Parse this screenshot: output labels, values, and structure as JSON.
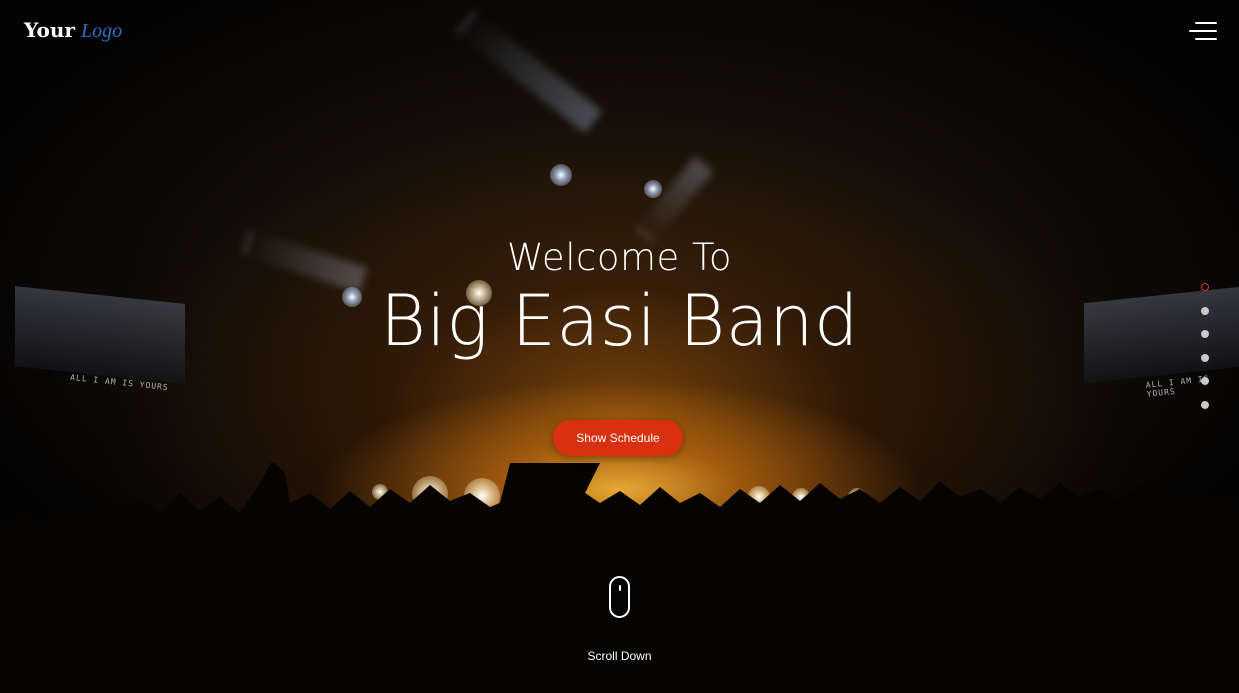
{
  "header": {
    "logo_word_1": "Your",
    "logo_word_2": "Logo",
    "menu_icon": "hamburger-menu-icon"
  },
  "hero": {
    "welcome_text": "Welcome To",
    "band_name": "Big Easi Band",
    "cta_label": "Show Schedule",
    "scroll_label": "Scroll Down",
    "screen_text_left": "ALL I AM IS YOURS",
    "screen_text_right": "ALL I AM IS YOURS"
  },
  "section_nav": {
    "active_index": 0,
    "count": 6
  },
  "colors": {
    "accent": "#d9300f",
    "active_dot": "#e0322b",
    "logo_blue": "#2f6fbf",
    "text": "#ffffff"
  }
}
